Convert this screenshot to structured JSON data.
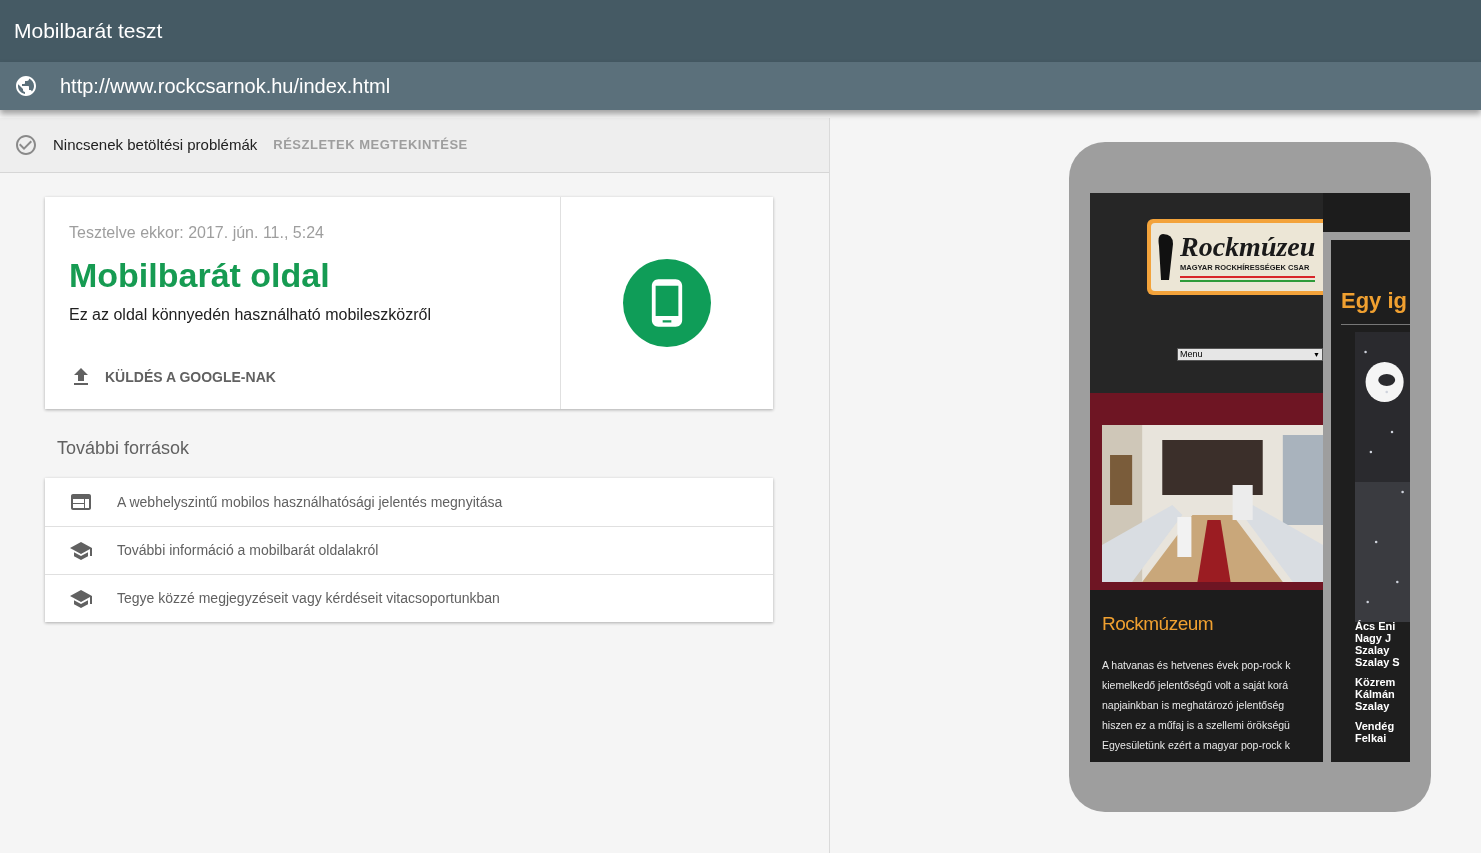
{
  "app": {
    "title": "Mobilbarát teszt"
  },
  "url_bar": {
    "url": "http://www.rockcsarnok.hu/index.html"
  },
  "status": {
    "message": "Nincsenek betöltési problémák",
    "details_link": "RÉSZLETEK MEGTEKINTÉSE"
  },
  "result": {
    "tested_at": "Tesztelve ekkor: 2017. jún. 11., 5:24",
    "verdict": "Mobilbarát oldal",
    "description": "Ez az oldal könnyedén használható mobileszközről",
    "submit_button": "KÜLDÉS A GOOGLE-NAK"
  },
  "resources": {
    "heading": "További források",
    "items": [
      {
        "kind": "report",
        "label": "A webhelyszintű mobilos használhatósági jelentés megnyitása"
      },
      {
        "kind": "learn",
        "label": "További információ a mobilbarát oldalakról"
      },
      {
        "kind": "learn",
        "label": "Tegye közzé megjegyzéseit vagy kérdéseit vitacsoportunkban"
      }
    ]
  },
  "preview": {
    "logo_title": "Rockmúzeu",
    "logo_subtitle": "MAGYAR ROCKHÍRESSÉGEK CSAR",
    "menu": "Menu",
    "menu_arrow": "▼",
    "heading": "Rockmúzeum",
    "paragraph_lines": [
      "A hatvanas és hetvenes évek pop-rock k",
      "kiemelkedő jelentőségű volt a saját korá",
      "napjainkban is meghatározó jelentőség",
      "hiszen ez a műfaj is a szellemi örökségü",
      "Egyesületünk ezért a magyar pop-rock k"
    ],
    "overlay": {
      "heading": "Egy ig",
      "name_groups": [
        [
          "Ács Eni",
          "Nagy J",
          "Szalay",
          "Szalay S"
        ],
        [
          "Közrem",
          "Kálmán",
          "Szalay"
        ],
        [
          "Vendég",
          "Felkai"
        ]
      ]
    }
  }
}
